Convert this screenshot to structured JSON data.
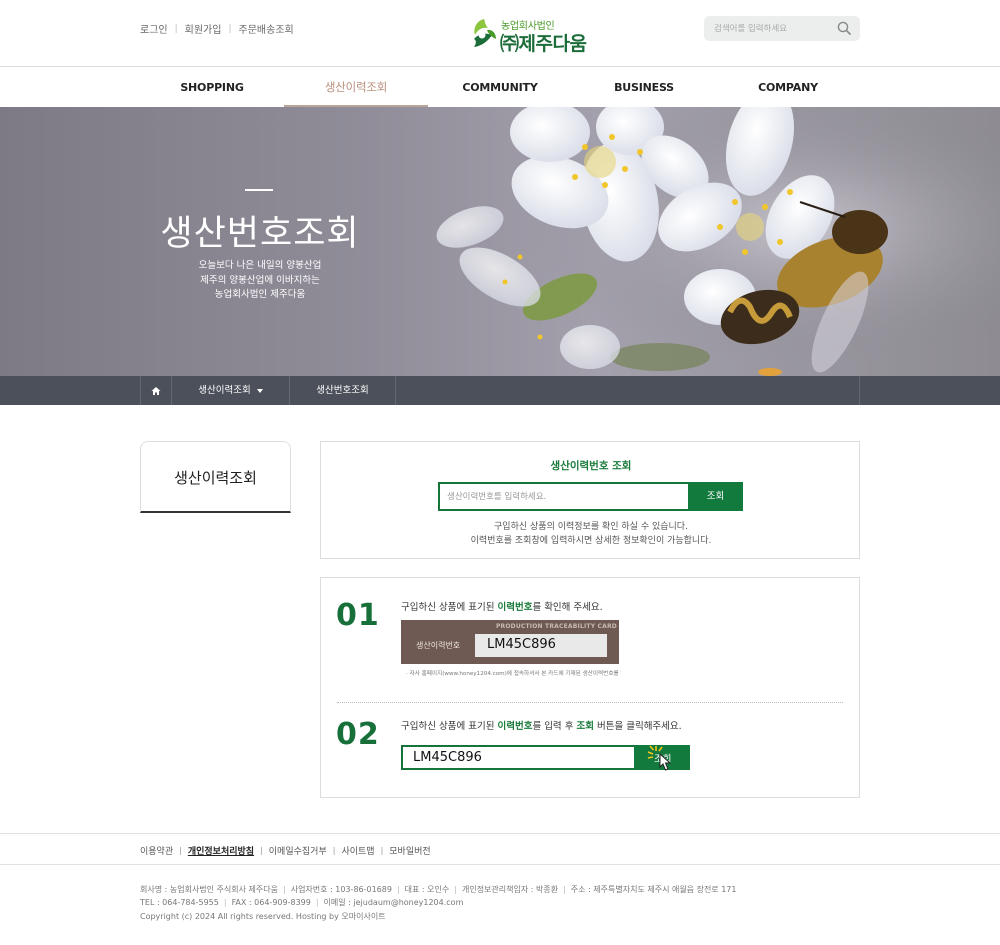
{
  "header": {
    "top_links": [
      "로그인",
      "회원가입",
      "주문배송조회"
    ],
    "logo": {
      "small": "농업회사법인",
      "big": "㈜제주다움"
    },
    "search_placeholder": "검색어를 입력하세요"
  },
  "nav": {
    "items": [
      "SHOPPING",
      "생산이력조회",
      "COMMUNITY",
      "BUSINESS",
      "COMPANY"
    ],
    "active_index": 1
  },
  "hero": {
    "title": "생산번호조회",
    "subtitle_lines": [
      "오늘보다 나은 내일의 양봉산업",
      "제주의 양봉산업에 이바지하는",
      "농업회사법인 제주다움"
    ]
  },
  "breadcrumb": {
    "home_icon": "home-icon",
    "level1": "생산이력조회",
    "level2": "생산번호조회"
  },
  "sidebar": {
    "title": "생산이력조회"
  },
  "lookup": {
    "title": "생산이력번호 조회",
    "placeholder": "생산이력번호를 입력하세요.",
    "button": "조회",
    "desc_lines": [
      "구입하신 상품의 이력정보를 확인 하실 수 있습니다.",
      "이력번호를 조회창에 입력하시면 상세한 정보확인이 가능합니다."
    ]
  },
  "steps": [
    {
      "num": "01",
      "text_before": "구입하신 상품에 표기된 ",
      "highlight": "이력번호",
      "text_after": "를 확인해 주세요.",
      "card": {
        "header": "PRODUCTION TRACEABILITY CARD",
        "label": "생산이력번호",
        "value": "LM45C896"
      },
      "note": "· 자사 홈페이지(www.honey1204.com)에 접속하셔서 본 카드에 기재된 생산이력번호를 입력하시면 생산자 정보 및 생산이력을 확인하실 수 있습니다."
    },
    {
      "num": "02",
      "text_before": "구입하신 상품에 표기된 ",
      "highlight": "이력번호",
      "text_mid": "를 입력 후 ",
      "highlight2": "조회",
      "text_after": " 버튼을 클릭해주세요.",
      "demo_value": "LM45C896",
      "demo_button": "조회"
    }
  ],
  "footer": {
    "links": [
      "이용약관",
      "개인정보처리방침",
      "이메일수집거부",
      "사이트맵",
      "모바일버전"
    ],
    "strong_index": 1,
    "info_row1": [
      "회사명 : 농업회사법인 주식회사 제주다움",
      "사업자번호 : 103-86-01689",
      "대표 : 오인수",
      "개인정보관리책임자 : 박종환",
      "주소 : 제주특별자치도 제주시 애월읍 장전로 171"
    ],
    "info_row2": [
      "TEL : 064-784-5955",
      "FAX : 064-909-8399",
      "이메일 : jejudaum@honey1204.com"
    ],
    "copyright": "Copyright (c) 2024 All rights reserved. Hosting by 오마이사이트"
  },
  "colors": {
    "brand_green": "#137a3e",
    "nav_active": "#b8907e",
    "crumb_bg": "#4c505a",
    "card_brown": "#6e5a52"
  }
}
